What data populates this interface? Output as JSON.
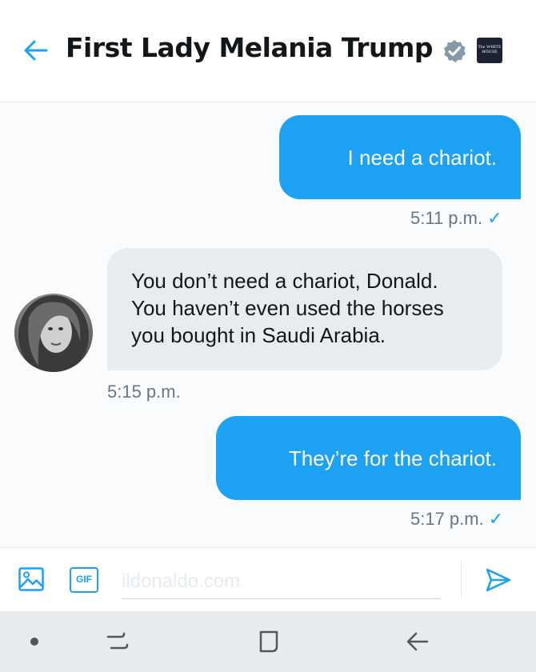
{
  "header": {
    "title": "First Lady Melania Trump",
    "logo_text": "The WHITE HOUSE"
  },
  "messages": [
    {
      "direction": "out",
      "text": "I need a chariot.",
      "time": "5:11 p.m.",
      "read": "✓"
    },
    {
      "direction": "in",
      "lines": [
        "You don’t need a chariot, Donald.",
        "You haven’t even used the horses",
        "you bought in Saudi Arabia."
      ],
      "time": "5:15 p.m."
    },
    {
      "direction": "out",
      "text": "They’re for the chariot.",
      "time": "5:17 p.m.",
      "read": "✓"
    }
  ],
  "composer": {
    "placeholder": "ildonaldo.com",
    "gif_label": "GIF"
  },
  "colors": {
    "accent": "#1da1f2",
    "incoming_bubble": "#e6ecf0",
    "navbar": "#e8ebee"
  },
  "icons": {
    "back": "arrow-left-icon",
    "verified": "verified-badge-icon",
    "image": "image-icon",
    "send": "send-icon",
    "nav_recent": "recent-apps-icon",
    "nav_home": "home-icon",
    "nav_back": "back-icon"
  }
}
